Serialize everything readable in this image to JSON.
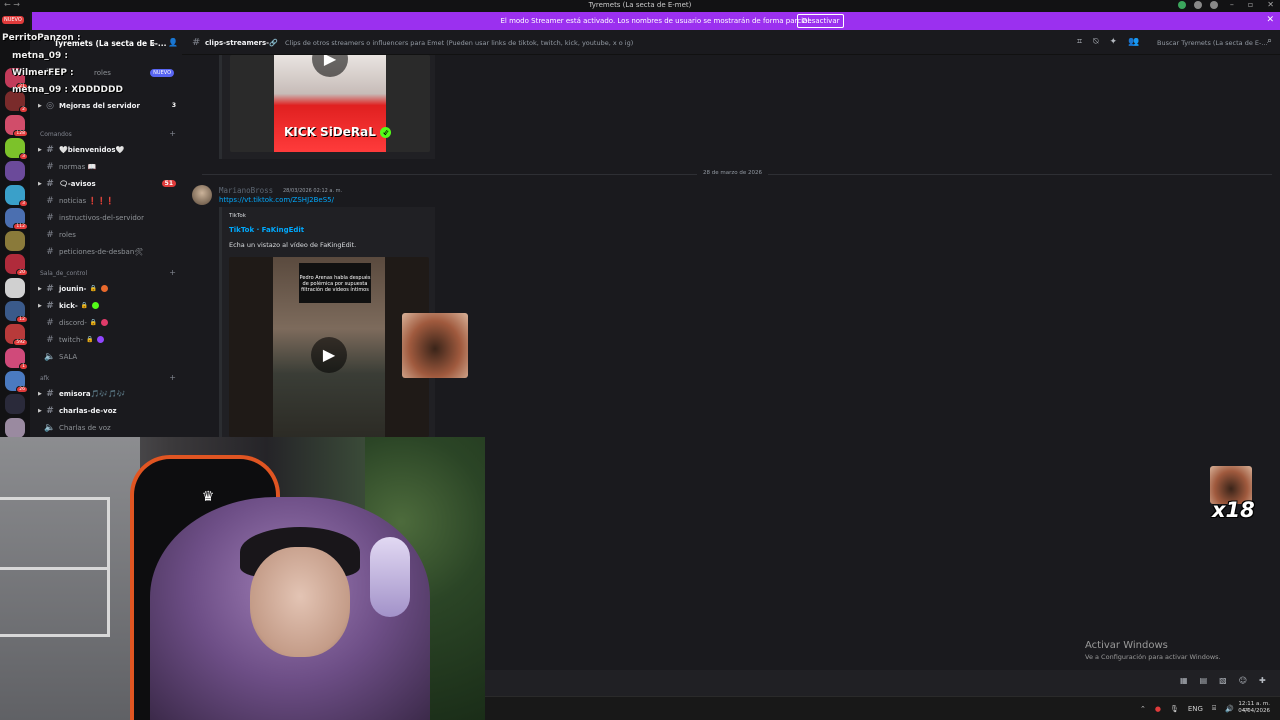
{
  "window": {
    "title": "Tyremets (La secta de E-met)",
    "nav_arrows": "← →"
  },
  "banner": {
    "text": "El modo Streamer está activado. Los nombres de usuario se mostrarán de forma parcial.",
    "button": "Desactivar"
  },
  "rail": {
    "nuevo": "NUEVO",
    "servers": [
      {
        "badge": "21",
        "color": "#c23b5a"
      },
      {
        "badge": "2",
        "color": "#7a2b2b"
      },
      {
        "badge": "128",
        "color": "#d14d6a"
      },
      {
        "badge": "3",
        "color": "#7cc22a"
      },
      {
        "badge": "",
        "color": "#6b4a9a"
      },
      {
        "badge": "3",
        "color": "#3aa0c9"
      },
      {
        "badge": "112",
        "color": "#4b6fb0"
      },
      {
        "badge": "",
        "color": "#8a7a3a"
      },
      {
        "badge": "20",
        "color": "#b02b3b"
      },
      {
        "badge": "",
        "color": "#d0d0d0"
      },
      {
        "badge": "12",
        "color": "#3a5a8a"
      },
      {
        "badge": "592",
        "color": "#b83a3a"
      },
      {
        "badge": "1",
        "color": "#d04a7a"
      },
      {
        "badge": "26",
        "color": "#4a7ac0"
      },
      {
        "badge": "",
        "color": "#2a2a3a"
      },
      {
        "badge": "",
        "color": "#9a8aa0"
      }
    ]
  },
  "overlay_chat": [
    "PerritoPanzon :",
    "metna_09 :",
    "WilmerFEP :",
    "metna_09 : XDDDDDD"
  ],
  "sidebar": {
    "server_name": "Tyremets (La secta de E-...",
    "roles_label": "roles",
    "nuevo": "NUEVO",
    "mejoras": {
      "label": "Mejoras del servidor",
      "count": "3"
    },
    "cat_comandos": "Comandos",
    "channels_a": [
      {
        "label": "🤍bienvenidos🤍",
        "bold": true
      },
      {
        "label": "normas 📖",
        "bold": false
      },
      {
        "label": "🗨-avisos",
        "bold": true,
        "count": "51"
      },
      {
        "label": "noticias ❗❗❗",
        "bold": false
      },
      {
        "label": "instructivos-del-servidor",
        "bold": false
      },
      {
        "label": "roles",
        "bold": false
      },
      {
        "label": "peticiones-de-desban🛠",
        "bold": false
      }
    ],
    "cat_sala": "Sala_de_control",
    "channels_b": [
      {
        "label": "jounin-",
        "bold": true,
        "dot": "#e9692c"
      },
      {
        "label": "kick-",
        "bold": true,
        "dot": "#53fc18"
      },
      {
        "label": "discord-",
        "bold": false,
        "dot": "#e03b6a"
      },
      {
        "label": "twitch-",
        "bold": false,
        "dot": "#9146ff"
      },
      {
        "label": "SALA",
        "bold": false,
        "voice": true
      }
    ],
    "cat_afk": "afk",
    "channels_c": [
      {
        "label": "emisora🎵🎶🎵🎶",
        "bold": true
      },
      {
        "label": "charlas-de-voz",
        "bold": true
      },
      {
        "label": "Charlas de voz",
        "bold": false,
        "voice": true
      }
    ]
  },
  "header": {
    "channel": "clips-streamers-🔗",
    "topic": "Clips de otros streamers o influencers para Emet (Pueden usar links de tiktok, twitch, kick, youtube, x o ig)",
    "search_placeholder": "Buscar Tyremets (La secta de E-..."
  },
  "messages": {
    "top_embed_label": "KICK SiDeRaL",
    "date_divider": "28 de marzo de 2026",
    "author": "MarianoBross",
    "timestamp": "28/03/2026 02:12 a. m.",
    "link": "https://vt.tiktok.com/ZSHJ2BeS5/",
    "embed": {
      "provider": "TikTok",
      "title": "TikTok · FaKingEdit",
      "description": "Echa un vistazo al vídeo de FaKingEdit.",
      "caption": "Pedro Arenas habla después de polémica por supuesta filtración de videos íntimos"
    }
  },
  "overlay": {
    "activate_title": "Activar Windows",
    "activate_sub": "Ve a Configuración para activar Windows.",
    "x18": "x18"
  },
  "tray": {
    "lang": "ENG",
    "time": "12:11 a. m.",
    "date": "04/04/2026"
  }
}
